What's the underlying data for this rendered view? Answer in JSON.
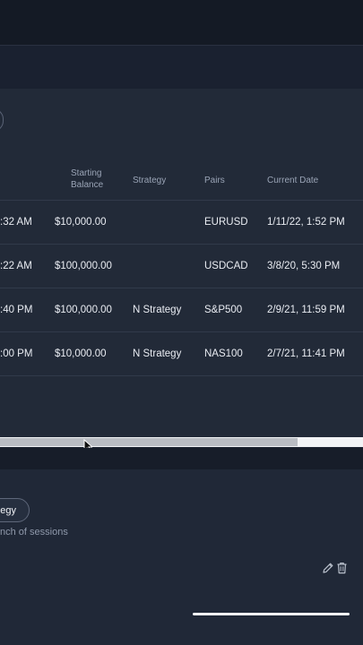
{
  "table": {
    "headers": {
      "starting_balance_line1": "Starting",
      "starting_balance_line2": "Balance",
      "strategy": "Strategy",
      "pairs": "Pairs",
      "current_date": "Current Date"
    },
    "rows": [
      {
        "time_fragment": ":32 AM",
        "starting_balance": "$10,000.00",
        "strategy": "",
        "pair": "EURUSD",
        "current_date": "1/11/22, 1:52 PM"
      },
      {
        "time_fragment": ":22 AM",
        "starting_balance": "$100,000.00",
        "strategy": "",
        "pair": "USDCAD",
        "current_date": "3/8/20, 5:30 PM"
      },
      {
        "time_fragment": ":40 PM",
        "starting_balance": "$100,000.00",
        "strategy": "N Strategy",
        "pair": "S&P500",
        "current_date": "2/9/21, 11:59 PM"
      },
      {
        "time_fragment": ":00 PM",
        "starting_balance": "$10,000.00",
        "strategy": "N Strategy",
        "pair": "NAS100",
        "current_date": "2/7/21, 11:41 PM"
      }
    ]
  },
  "scrollbar": {
    "thumb_fraction": 0.82
  },
  "strategy_section": {
    "button_label": "egy",
    "subtext": "nch of sessions"
  },
  "icons": {
    "edit": "pencil-icon",
    "delete": "trash-icon",
    "cursor": "mouse-pointer-icon"
  },
  "colors": {
    "background": "#1b2230",
    "panel": "#222a38",
    "text": "#e9ecf2",
    "muted": "#9aa4b6"
  }
}
